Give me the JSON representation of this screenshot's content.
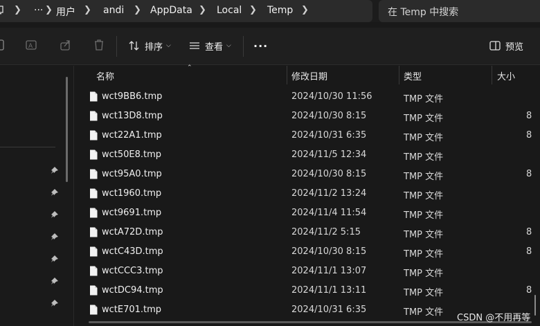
{
  "address": {
    "overflow": "···",
    "crumbs": [
      "用户",
      "andi",
      "AppData",
      "Local",
      "Temp"
    ]
  },
  "search": {
    "placeholder": "在 Temp 中搜索"
  },
  "toolbar": {
    "sort_label": "排序",
    "view_label": "查看",
    "more_label": "···",
    "preview_label": "预览"
  },
  "columns": {
    "name": "名称",
    "modified": "修改日期",
    "type": "类型",
    "size": "大小"
  },
  "files": [
    {
      "name": "wct9BB6.tmp",
      "modified": "2024/10/30 11:56",
      "type": "TMP 文件",
      "size": ""
    },
    {
      "name": "wct13D8.tmp",
      "modified": "2024/10/30 8:15",
      "type": "TMP 文件",
      "size": "8"
    },
    {
      "name": "wct22A1.tmp",
      "modified": "2024/10/31 6:35",
      "type": "TMP 文件",
      "size": "8"
    },
    {
      "name": "wct50E8.tmp",
      "modified": "2024/11/5 12:34",
      "type": "TMP 文件",
      "size": ""
    },
    {
      "name": "wct95A0.tmp",
      "modified": "2024/10/30 8:15",
      "type": "TMP 文件",
      "size": "8"
    },
    {
      "name": "wct1960.tmp",
      "modified": "2024/11/2 13:24",
      "type": "TMP 文件",
      "size": ""
    },
    {
      "name": "wct9691.tmp",
      "modified": "2024/11/4 11:54",
      "type": "TMP 文件",
      "size": ""
    },
    {
      "name": "wctA72D.tmp",
      "modified": "2024/11/2 5:15",
      "type": "TMP 文件",
      "size": "8"
    },
    {
      "name": "wctC43D.tmp",
      "modified": "2024/10/30 8:15",
      "type": "TMP 文件",
      "size": "8"
    },
    {
      "name": "wctCCC3.tmp",
      "modified": "2024/11/1 13:07",
      "type": "TMP 文件",
      "size": ""
    },
    {
      "name": "wctDC94.tmp",
      "modified": "2024/11/1 13:11",
      "type": "TMP 文件",
      "size": "8"
    },
    {
      "name": "wctE701.tmp",
      "modified": "2024/10/31 6:35",
      "type": "TMP 文件",
      "size": ""
    }
  ],
  "watermark": "CSDN @不用再等",
  "colors": {
    "background": "#191919",
    "panel": "#2b2b2b",
    "text": "#f0f0f0"
  }
}
